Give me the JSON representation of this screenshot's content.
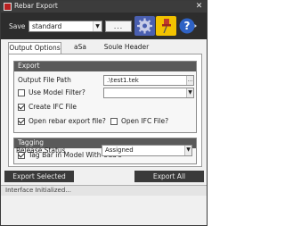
{
  "window": {
    "title": "Rebar Export",
    "close_glyph": "✕"
  },
  "toolbar": {
    "save_label": "Save",
    "preset_value": "standard",
    "save_button": "...",
    "icons": [
      "settings-icon",
      "pin-icon",
      "help-icon"
    ]
  },
  "tabs": [
    {
      "label": "Output Options",
      "active": true
    },
    {
      "label": "aSa Header",
      "active": false
    },
    {
      "label": "Soule Header",
      "active": false
    }
  ],
  "export_group": {
    "header": "Export",
    "output_path_label": "Output File Path",
    "output_path_value": ".\\test1.tek",
    "browse_glyph": "...",
    "use_model_filter_label": "Use Model Filter?",
    "use_model_filter_checked": false,
    "model_filter_value": "",
    "create_ifc_label": "Create IFC File",
    "create_ifc_checked": true,
    "open_rebar_label": "Open rebar export file?",
    "open_rebar_checked": true,
    "open_ifc_label": "Open IFC File?",
    "open_ifc_checked": false
  },
  "tagging_group": {
    "header": "Tagging",
    "tag_bar_label": "Tag Bar in Model With Uda's",
    "tag_bar_checked": true,
    "release_status_label": "Release Status",
    "release_status_value": "Assigned"
  },
  "buttons": {
    "export_selected": "Export Selected",
    "export_all": "Export All"
  },
  "status": {
    "text": "Interface Initialized..."
  },
  "colors": {
    "title_bar": "#3c3c3c",
    "toolbar": "#2d2d2d",
    "group_header": "#5a5a5a",
    "settings_icon_bg": "#4a5fb0",
    "pin_icon_bg": "#f2c200",
    "help_icon": "#2f62c4"
  }
}
